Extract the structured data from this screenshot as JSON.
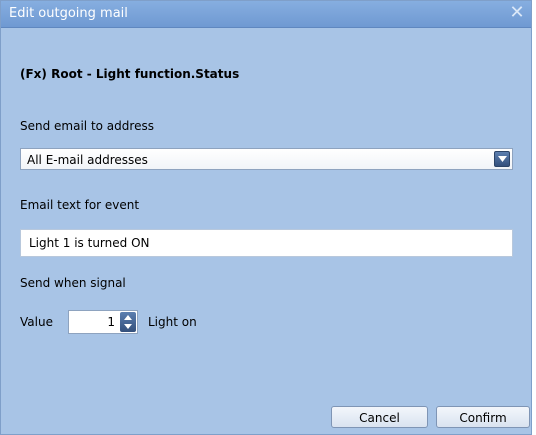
{
  "window": {
    "title": "Edit outgoing mail",
    "close_icon": "close-icon"
  },
  "heading": "(Fx) Root - Light function.Status",
  "email_address": {
    "label": "Send email to address",
    "selected": "All E-mail addresses"
  },
  "email_text": {
    "label": "Email text for event",
    "value": "Light 1 is turned ON"
  },
  "signal": {
    "label": "Send when signal",
    "value_label": "Value",
    "value": "1",
    "value_desc": "Light on"
  },
  "buttons": {
    "cancel": "Cancel",
    "confirm": "Confirm"
  },
  "colors": {
    "dialog_bg": "#a8c4e6",
    "titlebar": "#7aa3d9"
  }
}
